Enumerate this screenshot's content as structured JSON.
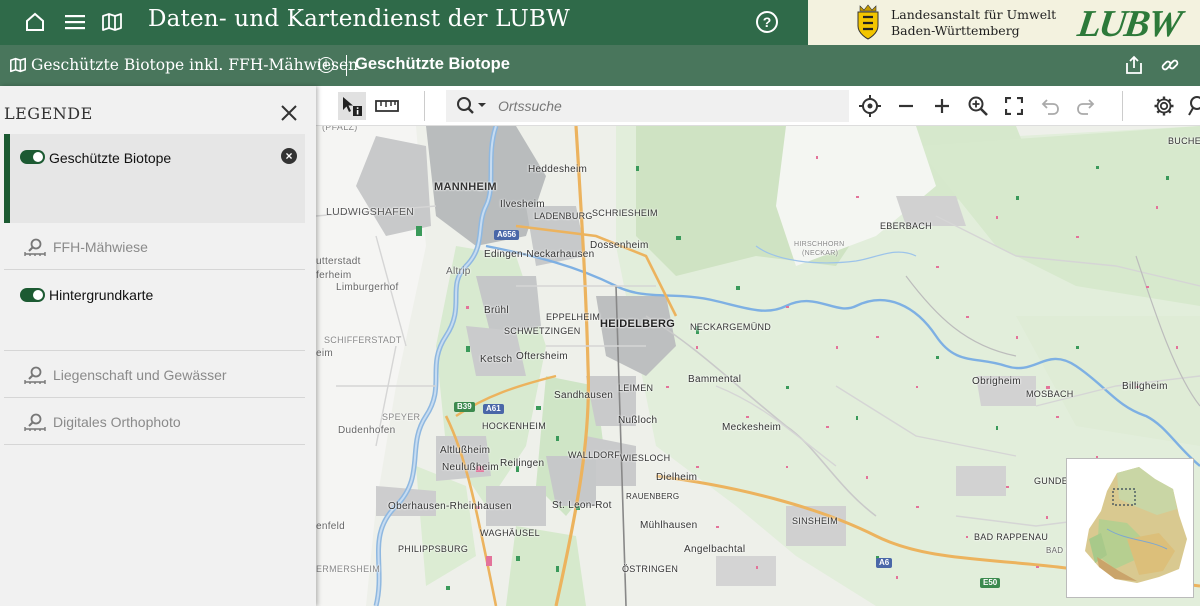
{
  "header": {
    "title": "Daten- und Kartendienst der LUBW",
    "help_label": "?",
    "org_line1": "Landesanstalt für Umwelt",
    "org_line2": "Baden-Württemberg",
    "logo_text": "LUBW"
  },
  "subbar": {
    "layer_name": "Geschützte Biotope inkl. FFH-Mähwiesen",
    "info_label": "i",
    "theme_title": "Geschützte Biotope"
  },
  "legend": {
    "title": "LEGENDE",
    "layers": [
      {
        "label": "Geschützte Biotope",
        "active": true
      },
      {
        "label": "FFH-Mähwiese",
        "active": false
      },
      {
        "label": "Hintergrundkarte",
        "active": true
      },
      {
        "label": "Liegenschaft und Gewässer",
        "active": false
      },
      {
        "label": "Digitales Orthophoto",
        "active": false
      }
    ]
  },
  "toolbar": {
    "search_placeholder": "Ortssuche"
  },
  "map": {
    "places": {
      "pfalz": "(PFALZ)",
      "mannheim": "MANNHEIM",
      "heddesheim": "Heddesheim",
      "ilvesheim": "Ilvesheim",
      "ladenburg": "LADENBURG",
      "schriesheim": "SCHRIESHEIM",
      "ludwigshafen": "LUDWIGSHAFEN",
      "dossenheim": "Dossenheim",
      "edingen": "Edingen-Neckarhausen",
      "hirschhorn": "HIRSCHHORN",
      "neckar": "(NECKAR)",
      "eberbach": "EBERBACH",
      "mutterstadt": "utterstadt",
      "ferheim": "ferheim",
      "limburgerhof": "Limburgerhof",
      "altrip": "Altrip",
      "bruehl": "Brühl",
      "eppelheim": "EPPELHEIM",
      "heidelberg": "HEIDELBERG",
      "neckargemund": "NECKARGEMÜND",
      "schwetzingen": "SCHWETZINGEN",
      "schifferstadt": "SCHIFFERSTADT",
      "eim": "eim",
      "ketsch": "Ketsch",
      "oftersheim": "Oftersheim",
      "bammental": "Bammental",
      "obrigheim": "Obrigheim",
      "mosbach": "MOSBACH",
      "billigheim": "Billigheim",
      "leimen": "LEIMEN",
      "sandhausen": "Sandhausen",
      "speyer": "SPEYER",
      "dudenhofen": "Dudenhofen",
      "hockenheim": "HOCKENHEIM",
      "nussloch": "Nußloch",
      "meckesheim": "Meckesheim",
      "altlussheim": "Altlußheim",
      "neulussheim": "Neulußheim",
      "reilingen": "Reilingen",
      "walldorf": "WALLDORF",
      "wiesloch": "WIESLOCH",
      "dielheim": "Dielheim",
      "gundelsheim": "GUNDEL",
      "rauenberg": "RAUENBERG",
      "oberhausen": "Oberhausen-Rheinhausen",
      "st_leon": "St. Leon-Rot",
      "sinsheim": "SINSHEIM",
      "muehlhausen": "Mühlhausen",
      "enfeld": "enfeld",
      "waghaeusel": "WAGHÄUSEL",
      "bad_rappenau": "BAD RAPPENAU",
      "bad_wimpfen": "BAD WIM",
      "philippsburg": "PHILIPPSBURG",
      "angelbachtal": "Angelbachtal",
      "germersheim": "ERMERSHEIM",
      "ostringen": "ÖSTRINGEN",
      "buchen": "BUCHE"
    },
    "roads": {
      "a656": "A656",
      "a61": "A61",
      "b39": "B39",
      "a6": "A6",
      "e50": "E50"
    }
  }
}
